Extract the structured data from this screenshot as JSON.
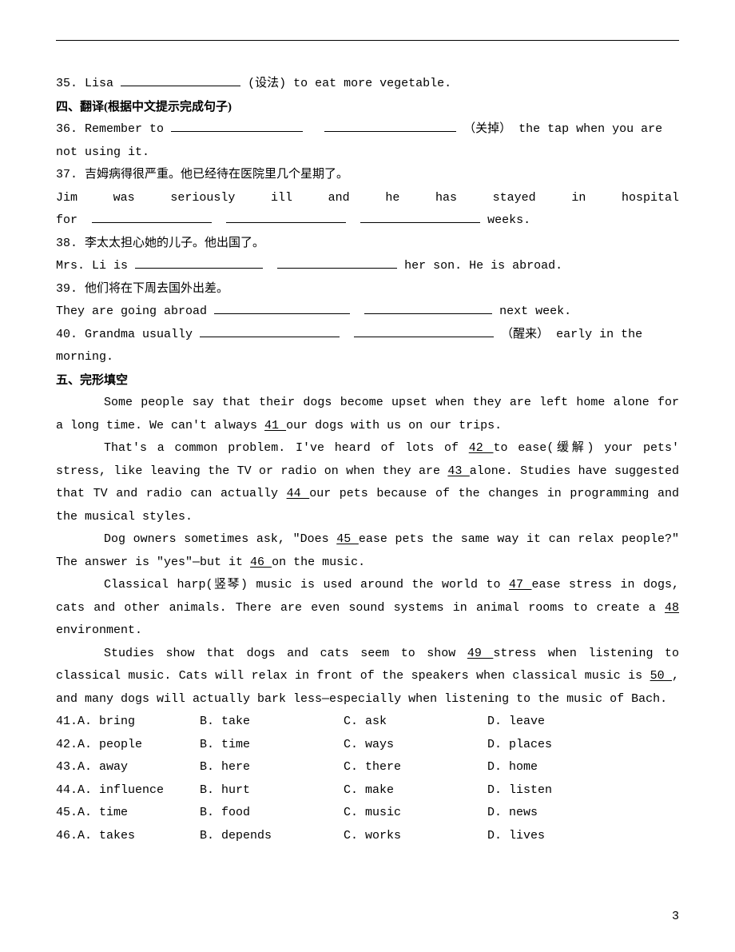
{
  "q35": {
    "num": "35.",
    "pre": "Lisa ",
    "hint": "(设法)",
    "post": " to eat more vegetable."
  },
  "sec4_title": "四、翻译(根据中文提示完成句子)",
  "q36": {
    "num": "36.",
    "pre": "Remember to ",
    "hint": "（关掉）",
    "post": "the tap when you are",
    "line2": "not using it."
  },
  "q37": {
    "num": "37.",
    "zh": "吉姆病得很严重。他已经待在医院里几个星期了。",
    "en_pre": "Jim   was   seriously   ill   and   he   has   stayed   in   hospital",
    "en_l2_pre": "for",
    "en_l2_post": " weeks."
  },
  "q38": {
    "num": "38.",
    "zh": "李太太担心她的儿子。他出国了。",
    "en_pre": "Mrs. Li is ",
    "en_post": " her son. He is abroad."
  },
  "q39": {
    "num": "39.",
    "zh": "他们将在下周去国外出差。",
    "en_pre": "They are going abroad ",
    "en_post": " next week."
  },
  "q40": {
    "num": "40.",
    "pre": "Grandma usually ",
    "hint": "（醒来）",
    "post": " early in the",
    "line2": "morning."
  },
  "sec5_title": "五、完形填空",
  "cloze": {
    "p1_a": "Some people say that their dogs become upset when they are left home alone for a long time. We can't always ",
    "n41": "   41    ",
    "p1_b": " our dogs with us on our trips.",
    "p2_a": "That's a common problem. I've heard of lots of ",
    "n42": "   42    ",
    "p2_b": " to ease(缓解) your  pets'  stress,  like  leaving  the  TV  or  radio  on  when  they  are ",
    "n43": "43       ",
    "p2_c": "  alone.  Studies  have  suggested  that  TV  and  radio  can  actually ",
    "n44": "44     ",
    "p2_d": " our pets because of the changes in programming and the musical styles.",
    "p3_a": "Dog owners sometimes ask, \"Does ",
    "n45": "   45    ",
    "p3_b": " ease pets the same way it can relax people?\" The answer is \"yes\"—but it ",
    "n46": "   46    ",
    "p3_c": " on the music.",
    "p4_a": "Classical harp(竖琴) music is used around the world to ",
    "n47": "    47     ",
    "p4_b": " ease stress in dogs, cats and other animals. There are even sound systems in animal rooms to create a ",
    "n48": "   48    ",
    "p4_c": " environment.",
    "p5_a": "Studies show that dogs and cats seem to show ",
    "n49": "    49     ",
    "p5_b": " stress when listening to classical music. Cats will relax in front of the speakers when classical music is ",
    "n50": "   50    ",
    "p5_c": ", and many dogs will actually bark less—especially when listening to the music of Bach."
  },
  "opts": {
    "r41": {
      "q": "41.",
      "a": "A. bring",
      "b": "B. take",
      "c": "C. ask",
      "d": "D. leave"
    },
    "r42": {
      "q": "42.",
      "a": "A. people",
      "b": "B. time",
      "c": "C. ways",
      "d": "D. places"
    },
    "r43": {
      "q": "43.",
      "a": "A. away",
      "b": "B. here",
      "c": "C. there",
      "d": "D. home"
    },
    "r44": {
      "q": "44.",
      "a": "A. influence",
      "b": "B. hurt",
      "c": "C. make",
      "d": "D. listen"
    },
    "r45": {
      "q": "45.",
      "a": "A. time",
      "b": "B. food",
      "c": "C. music",
      "d": "D. news"
    },
    "r46": {
      "q": "46.",
      "a": "A. takes",
      "b": "B. depends",
      "c": "C. works",
      "d": "D. lives"
    }
  },
  "page_num": "3"
}
